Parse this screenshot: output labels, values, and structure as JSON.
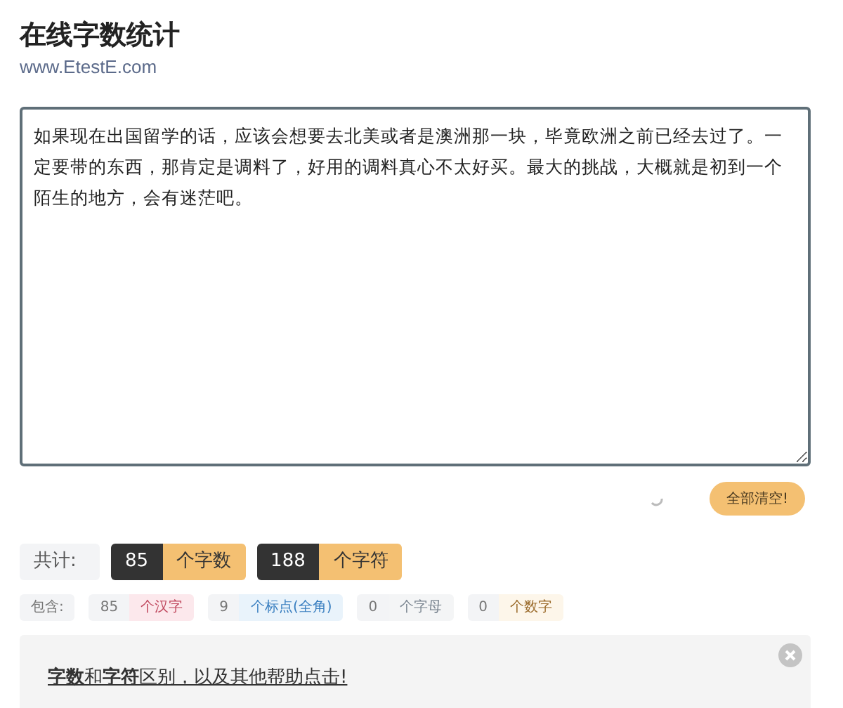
{
  "title": "在线字数统计",
  "subtitle": "www.EtestE.com",
  "text_input": {
    "value": "如果现在出国留学的话，应该会想要去北美或者是澳洲那一块，毕竟欧洲之前已经去过了。一定要带的东西，那肯定是调料了，好用的调料真心不太好买。最大的挑战，大概就是初到一个陌生的地方，会有迷茫吧。"
  },
  "clear_button": "全部清空!",
  "totals": {
    "label": "共计:",
    "items": [
      {
        "count": "85",
        "unit": "个字数"
      },
      {
        "count": "188",
        "unit": "个字符"
      }
    ]
  },
  "breakdown": {
    "label": "包含:",
    "items": [
      {
        "count": "85",
        "unit": "个汉字",
        "color": "#fce8ec"
      },
      {
        "count": "9",
        "unit": "个标点(全角)",
        "color": "#e9f3fb"
      },
      {
        "count": "0",
        "unit": "个字母",
        "color": "#f4f5f6"
      },
      {
        "count": "0",
        "unit": "个数字",
        "color": "#fdf6ea"
      }
    ]
  },
  "help": {
    "text": "**字数**和**字符**区别，以及其他帮助点击!"
  }
}
